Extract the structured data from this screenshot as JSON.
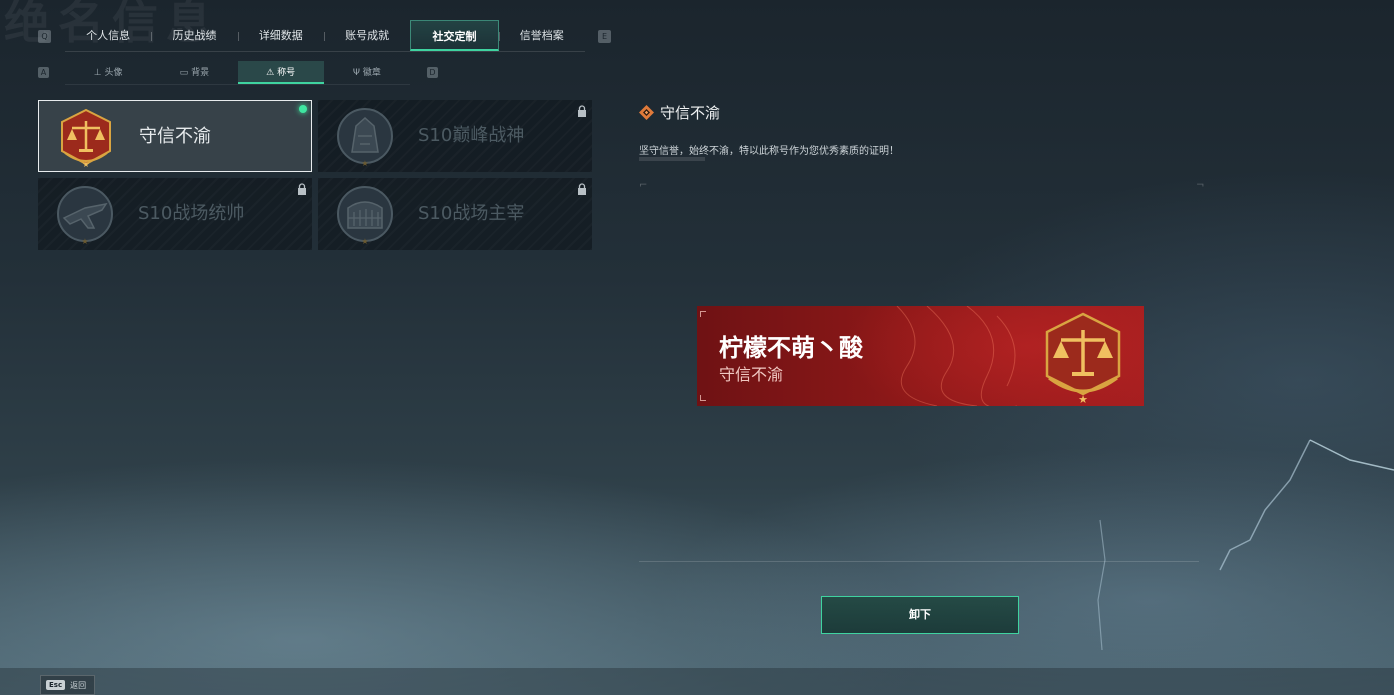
{
  "watermark_text": "绝名信息",
  "key_hints": {
    "left_main": "Q",
    "right_main": "E",
    "left_sub": "A",
    "right_sub": "D"
  },
  "tabs": [
    {
      "label": "个人信息",
      "active": false
    },
    {
      "label": "历史战绩",
      "active": false
    },
    {
      "label": "详细数据",
      "active": false
    },
    {
      "label": "账号成就",
      "active": false
    },
    {
      "label": "社交定制",
      "active": true
    },
    {
      "label": "信誉档案",
      "active": false
    }
  ],
  "subtabs": [
    {
      "label": "头像",
      "icon": "avatar-icon",
      "glyph": "⊥",
      "active": false
    },
    {
      "label": "背景",
      "icon": "background-icon",
      "glyph": "▭",
      "active": false
    },
    {
      "label": "称号",
      "icon": "title-icon",
      "glyph": "⚠",
      "active": true
    },
    {
      "label": "徽章",
      "icon": "badge-icon",
      "glyph": "Ψ",
      "active": false
    }
  ],
  "titles": [
    {
      "label": "守信不渝",
      "selected": true,
      "locked": false,
      "equipped": true,
      "emblem": "scales-emblem-icon"
    },
    {
      "label": "S10巅峰战神",
      "selected": false,
      "locked": true,
      "equipped": false,
      "emblem": "warrior-emblem-icon"
    },
    {
      "label": "S10战场统帅",
      "selected": false,
      "locked": true,
      "equipped": false,
      "emblem": "aircraft-emblem-icon"
    },
    {
      "label": "S10战场主宰",
      "selected": false,
      "locked": true,
      "equipped": false,
      "emblem": "colosseum-emblem-icon"
    }
  ],
  "detail": {
    "title": "守信不渝",
    "description": "坚守信誉，始终不渝，特以此称号作为您优秀素质的证明！"
  },
  "nameplate": {
    "player_name": "柠檬不萌丶酸",
    "title": "守信不渝",
    "background_color": "#8c1818"
  },
  "actions": {
    "unequip_label": "卸下",
    "esc_key": "Esc",
    "back_label": "返回"
  },
  "colors": {
    "accent": "#3fd3a0",
    "equipped_dot": "#3fe6a1",
    "emblem_gold": "#d9a441",
    "emblem_red": "#9c2a1c"
  }
}
